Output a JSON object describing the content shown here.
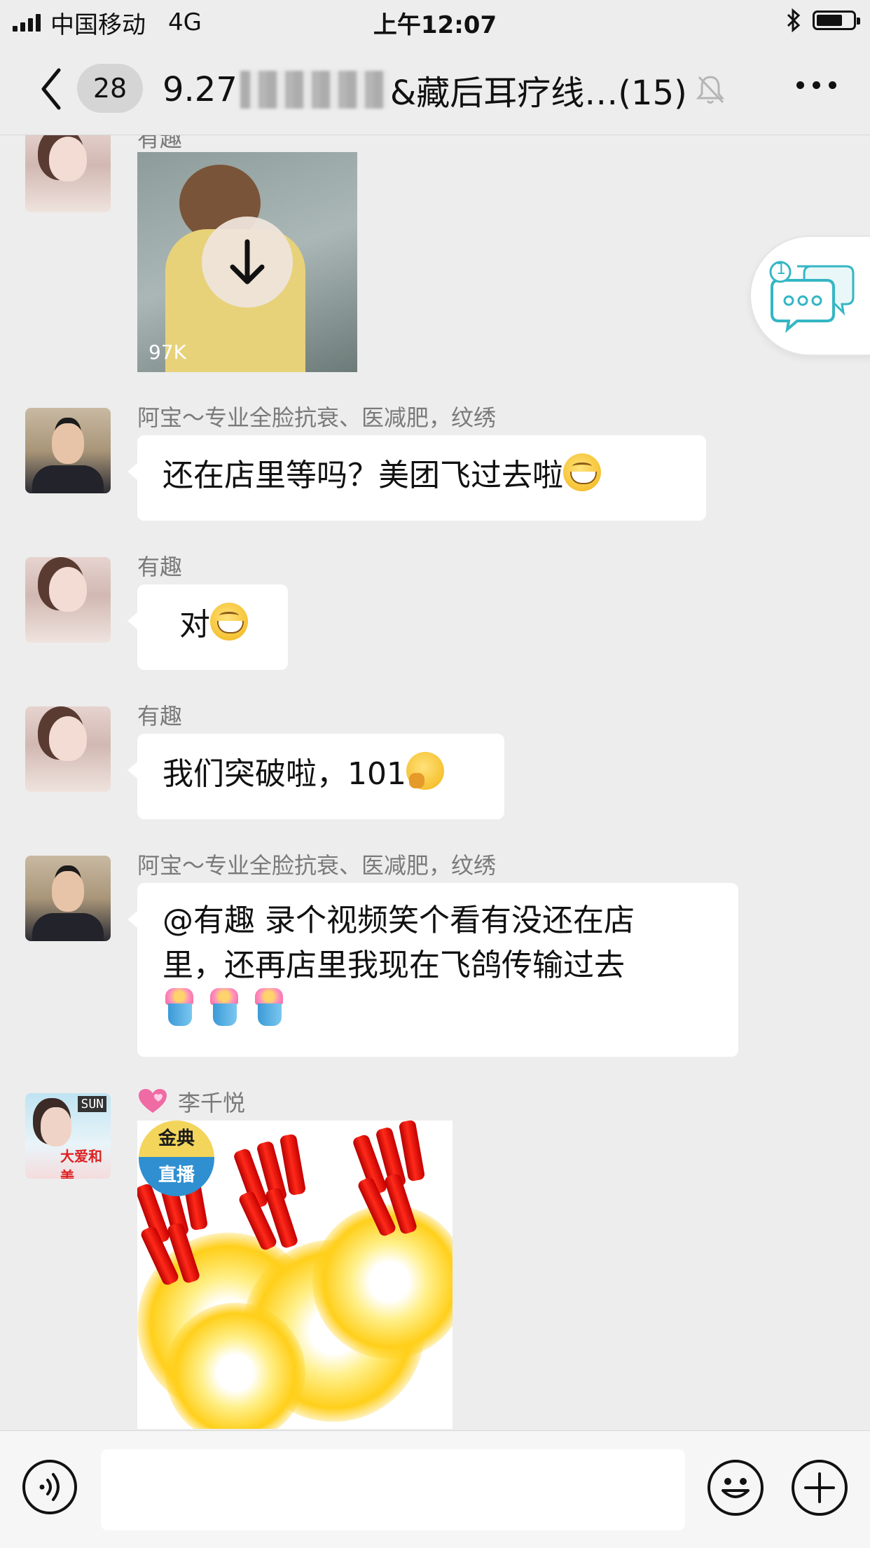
{
  "status_bar": {
    "carrier": "中国移动",
    "network": "4G",
    "time": "上午12:07"
  },
  "nav": {
    "unread_count": "28",
    "title_prefix": "9.27",
    "title_suffix": "&藏后耳疗线…(15)"
  },
  "messages": [
    {
      "type": "image",
      "sender": "有趣",
      "size_label": "97K"
    },
    {
      "type": "text",
      "sender": "阿宝～专业全脸抗衰、医减肥，纹绣",
      "text": "还在店里等吗？美团飞过去啦"
    },
    {
      "type": "text",
      "sender": "有趣",
      "text": "对"
    },
    {
      "type": "text",
      "sender": "有趣",
      "text": "我们突破啦，101"
    },
    {
      "type": "text",
      "sender": "阿宝～专业全脸抗衰、医减肥，纹绣",
      "text_line1": "@有趣 录个视频笑个看有没还在店",
      "text_line2": "里，还再店里我现在飞鸽传输过去"
    },
    {
      "type": "image",
      "sender": "李千悦",
      "badge_top": "金典",
      "badge_bottom": "直播"
    }
  ],
  "avatars": {
    "li_tag": "SUN",
    "li_text": "大爱和美"
  },
  "floating_badge": "1",
  "input": {
    "placeholder": ""
  },
  "icons": [
    "back-chevron-icon",
    "mute-bell-icon",
    "more-icon",
    "bluetooth-icon",
    "battery-icon",
    "download-icon",
    "voice-icon",
    "emoji-icon",
    "plus-icon",
    "chat-bubble-icon"
  ]
}
